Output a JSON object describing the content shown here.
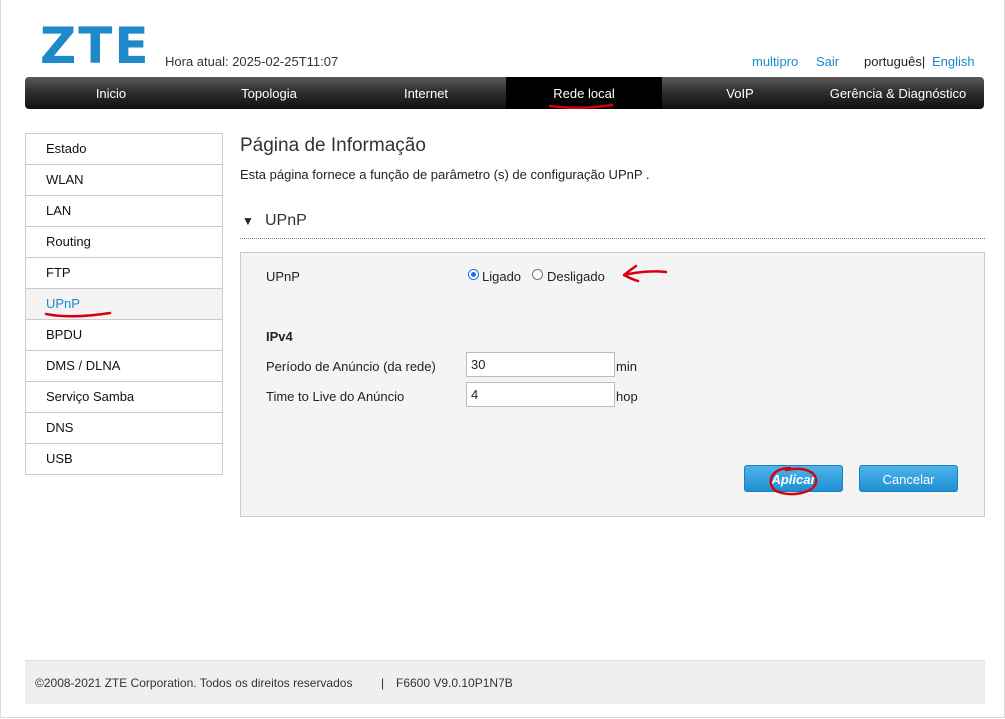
{
  "header": {
    "logo_text": "ZTE",
    "time_label": "Hora atual: 2025-02-25T11:07",
    "user": "multipro",
    "logout": "Sair",
    "lang_pt": "português|",
    "lang_en": "English"
  },
  "nav": {
    "items": [
      "Inicio",
      "Topologia",
      "Internet",
      "Rede local",
      "VoIP",
      "Gerência & Diagnóstico"
    ],
    "active": "Rede local"
  },
  "sidebar": {
    "items": [
      "Estado",
      "WLAN",
      "LAN",
      "Routing",
      "FTP",
      "UPnP",
      "BPDU",
      "DMS / DLNA",
      "Serviço Samba",
      "DNS",
      "USB"
    ],
    "active": "UPnP"
  },
  "page": {
    "title": "Página de Informação",
    "description": "Esta página fornece a função de parâmetro (s) de configuração UPnP .",
    "section": "UPnP"
  },
  "form": {
    "upnp_label": "UPnP",
    "radio_on": "Ligado",
    "radio_off": "Desligado",
    "selected": "Ligado",
    "ipv4_heading": "IPv4",
    "period_label": "Período de Anúncio (da rede)",
    "period_value": "30",
    "period_unit": "min",
    "ttl_label": "Time to Live do Anúncio",
    "ttl_value": "4",
    "ttl_unit": "hop",
    "apply": "Aplicar",
    "cancel": "Cancelar"
  },
  "footer": {
    "copyright": "©2008-2021 ZTE Corporation. Todos os direitos reservados",
    "separator": "|",
    "version": "F6600 V9.0.10P1N7B"
  },
  "colors": {
    "accent": "#1a8ad0",
    "annotation": "#d8000f"
  }
}
